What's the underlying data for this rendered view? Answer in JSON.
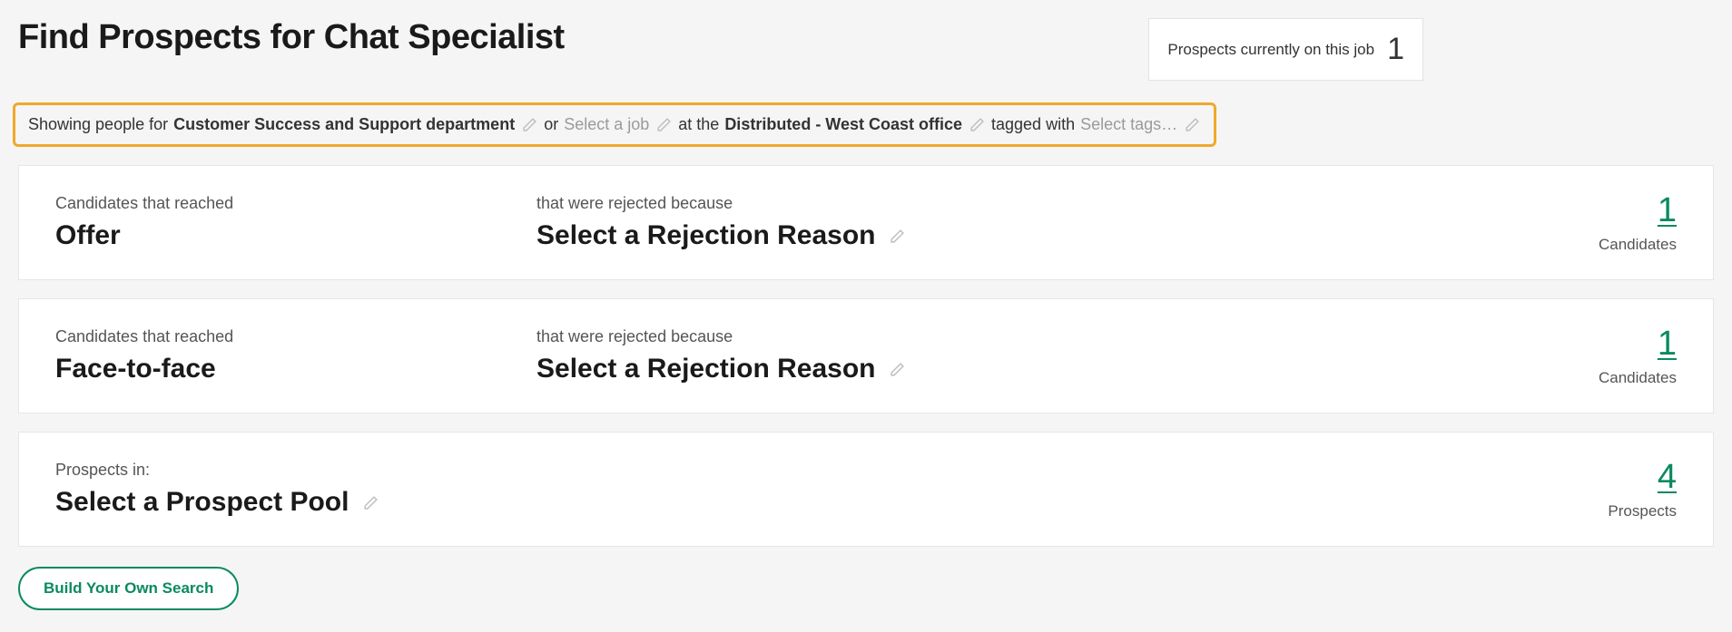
{
  "header": {
    "title": "Find Prospects for Chat Specialist",
    "badge_label": "Prospects currently on this job",
    "badge_count": "1"
  },
  "filter": {
    "prefix": "Showing people for",
    "department": "Customer Success and Support department",
    "or_text": "or",
    "job_placeholder": "Select a job",
    "at_text": "at the",
    "office": "Distributed - West Coast office",
    "tagged_text": "tagged with",
    "tags_placeholder": "Select tags…"
  },
  "cards": [
    {
      "left_label": "Candidates that reached",
      "left_value": "Offer",
      "mid_label": "that were rejected because",
      "mid_value": "Select a Rejection Reason",
      "count": "1",
      "count_label": "Candidates"
    },
    {
      "left_label": "Candidates that reached",
      "left_value": "Face-to-face",
      "mid_label": "that were rejected because",
      "mid_value": "Select a Rejection Reason",
      "count": "1",
      "count_label": "Candidates"
    },
    {
      "left_label": "Prospects in:",
      "left_value": "Select a Prospect Pool",
      "mid_label": "",
      "mid_value": "",
      "count": "4",
      "count_label": "Prospects"
    }
  ],
  "build_button": "Build Your Own Search"
}
